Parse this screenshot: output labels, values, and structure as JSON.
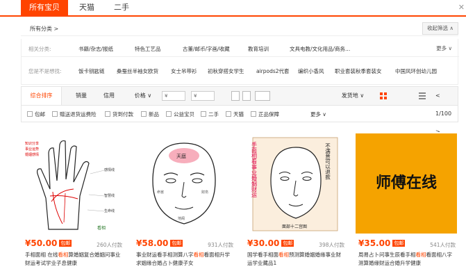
{
  "tabs": [
    "所有宝贝",
    "天猫",
    "二手"
  ],
  "category": {
    "all_label": "所有分类 >",
    "collapse_label": "收起筛选 ∧"
  },
  "filters": {
    "related_label": "相关分类:",
    "related": [
      "书籍/杂志/报纸",
      "特色工艺品",
      "古董/邮币/字画/收藏",
      "教育培训",
      "文具电教/文化用品/商务..."
    ],
    "more": "更多 ∨",
    "guess_label": "您是不是想找:",
    "guess": [
      "饭卡钥匙链",
      "桑蚕丝半袖女欧货",
      "女士吊带衫",
      "初秋穿搭女学生",
      "airpods2代套",
      "编织小香风",
      "职业套装秋季套装女",
      "中国风环创幼儿园"
    ]
  },
  "sortbar": {
    "items": [
      "综合排序",
      "销量",
      "信用",
      "价格 ∨"
    ],
    "price_from": "¥",
    "price_to": "¥",
    "ship_from": "发货地 ∨",
    "page": "1/100",
    "prev": "<",
    "next": ">"
  },
  "checks": [
    "包邮",
    "赠送退货运费险",
    "货到付款",
    "新品",
    "公益宝贝",
    "二手",
    "天猫",
    "正品保障"
  ],
  "checks_more": "更多 ∨",
  "products": [
    {
      "price": "¥50.00",
      "tag": "包邮",
      "sold": "260人付款",
      "title_pre": "手相面相 在线",
      "title_hl": "看相",
      "title_post": "算婚姻复合婚姻问事业财运考试学业子息健康"
    },
    {
      "price": "¥58.00",
      "tag": "包邮",
      "sold": "931人付款",
      "title_pre": "事业财运看手相测算八字",
      "title_hl": "看相",
      "title_post": "看面相升学求姻缘合婚占卜健康子女"
    },
    {
      "price": "¥30.00",
      "tag": "包邮",
      "sold": "398人付款",
      "title_pre": "国学看手相面",
      "title_hl": "看相",
      "title_post": "预测算婚姻婚缘事业财运学业藏品1"
    },
    {
      "price": "¥35.00",
      "tag": "包邮",
      "sold": "541人付款",
      "title_pre": "周易占卜问事生辰看手相",
      "title_hl": "看相",
      "title_post": "看面相八字测算婚缘财运合婚升学健康"
    }
  ],
  "card_images": {
    "palm_text": "生命线",
    "face_top": "天庭",
    "face3_vert": "手面相看事业婚姻财运",
    "face3_side": "不满意可以退款",
    "face3_bottom": "面部十二宫图",
    "master_text": "师傅在线"
  },
  "colors": {
    "accent": "#ff4400",
    "banner": "#f5a300"
  }
}
